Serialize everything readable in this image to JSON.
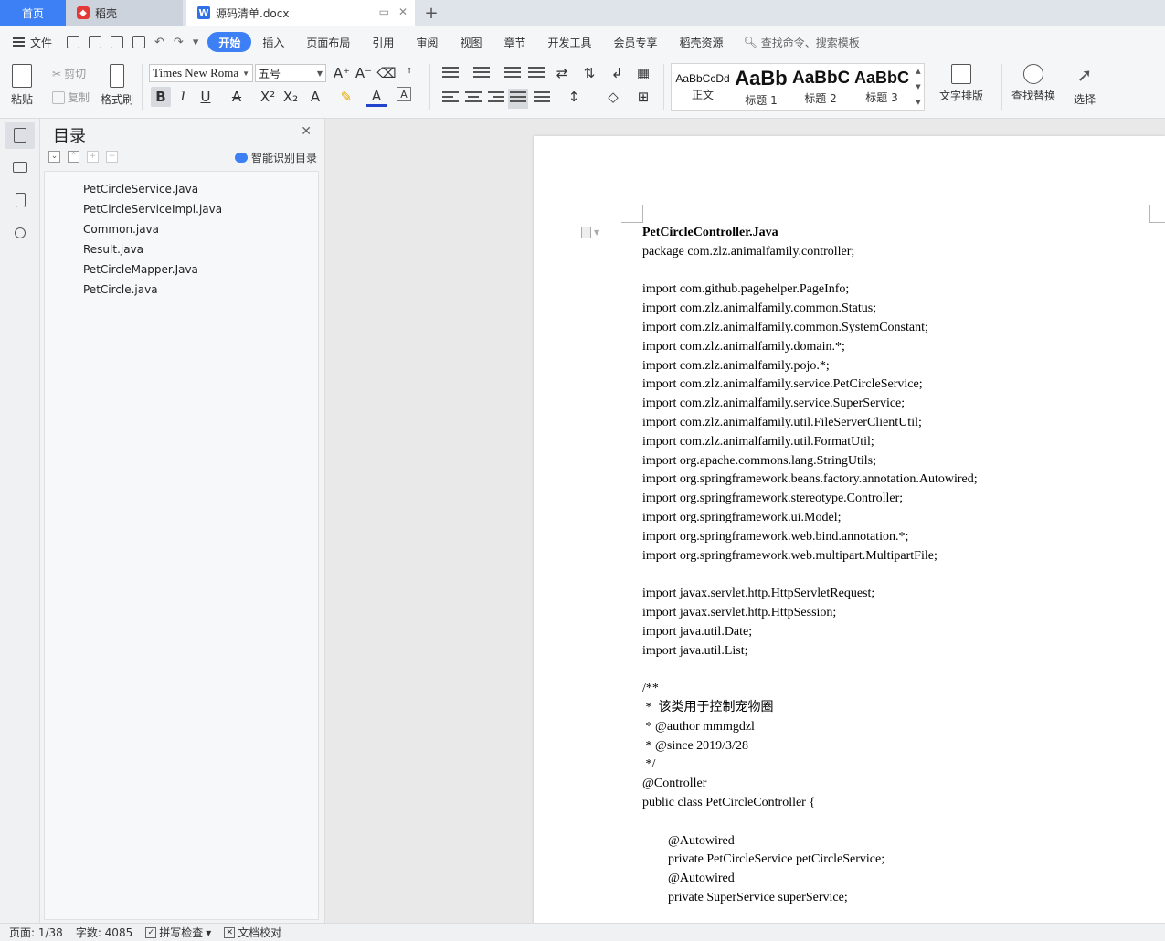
{
  "tabs": {
    "home": "首页",
    "docer": "稻壳",
    "document": "源码清单.docx",
    "new_tab": "+"
  },
  "menubar": {
    "file": "文件",
    "tabs": [
      "开始",
      "插入",
      "页面布局",
      "引用",
      "审阅",
      "视图",
      "章节",
      "开发工具",
      "会员专享",
      "稻壳资源"
    ],
    "active_tab": "开始",
    "search": "查找命令、搜索模板"
  },
  "ribbon": {
    "paste": "粘贴",
    "cut": "剪切",
    "copy": "复制",
    "format_painter": "格式刷",
    "font_name": "Times New Roma",
    "font_size": "五号",
    "styles": [
      {
        "sample": "AaBbCcDd",
        "name": "正文"
      },
      {
        "sample": "AaBb",
        "name": "标题 1"
      },
      {
        "sample": "AaBbC",
        "name": "标题 2"
      },
      {
        "sample": "AaBbC",
        "name": "标题 3"
      }
    ],
    "text_layout": "文字排版",
    "find_replace": "查找替换",
    "select": "选择"
  },
  "navpane": {
    "title": "目录",
    "smart_toc": "智能识别目录",
    "items": [
      "PetCircleService.Java",
      "PetCircleServiceImpl.java",
      "Common.java",
      "Result.java",
      "PetCircleMapper.Java",
      "PetCircle.java"
    ]
  },
  "document": {
    "title": "PetCircleController.Java",
    "lines": [
      {
        "text": "package com.zlz.animalfamily.controller;"
      },
      {
        "text": ""
      },
      {
        "text": "import com.github.pagehelper.PageInfo;"
      },
      {
        "text": "import com.zlz.animalfamily.common.Status;"
      },
      {
        "text": "import com.zlz.animalfamily.common.SystemConstant;"
      },
      {
        "text": "import com.zlz.animalfamily.domain.*;"
      },
      {
        "text": "import com.zlz.animalfamily.pojo.*;"
      },
      {
        "text": "import com.zlz.animalfamily.service.PetCircleService;"
      },
      {
        "text": "import com.zlz.animalfamily.service.SuperService;"
      },
      {
        "text": "import com.zlz.animalfamily.util.FileServerClientUtil;"
      },
      {
        "text": "import com.zlz.animalfamily.util.FormatUtil;"
      },
      {
        "text": "import org.apache.commons.lang.StringUtils;"
      },
      {
        "text": "import org.springframework.beans.factory.annotation.Autowired;"
      },
      {
        "text": "import org.springframework.stereotype.Controller;"
      },
      {
        "text": "import org.springframework.ui.Model;"
      },
      {
        "text": "import org.springframework.web.bind.annotation.*;"
      },
      {
        "text": "import org.springframework.web.multipart.MultipartFile;"
      },
      {
        "text": ""
      },
      {
        "text": "import javax.servlet.http.HttpServletRequest;"
      },
      {
        "text": "import javax.servlet.http.HttpSession;"
      },
      {
        "text": "import java.util.Date;"
      },
      {
        "text": "import java.util.List;"
      },
      {
        "text": ""
      },
      {
        "text": "/**"
      },
      {
        "text": " *  该类用于控制宠物圈"
      },
      {
        "text": " * @author mmmgdzl"
      },
      {
        "text": " * @since 2019/3/28"
      },
      {
        "text": " */"
      },
      {
        "text": "@Controller"
      },
      {
        "text": "public class PetCircleController {"
      },
      {
        "text": ""
      },
      {
        "text": "@Autowired",
        "indent": true
      },
      {
        "text": "private PetCircleService petCircleService;",
        "indent": true
      },
      {
        "text": "@Autowired",
        "indent": true
      },
      {
        "text": "private SuperService superService;",
        "indent": true
      }
    ]
  },
  "statusbar": {
    "page": "页面: 1/38",
    "words": "字数: 4085",
    "spellcheck": "拼写检查",
    "proofread": "文档校对"
  },
  "colors": {
    "accent": "#3d7ff5",
    "squiggle": "#e53935"
  }
}
